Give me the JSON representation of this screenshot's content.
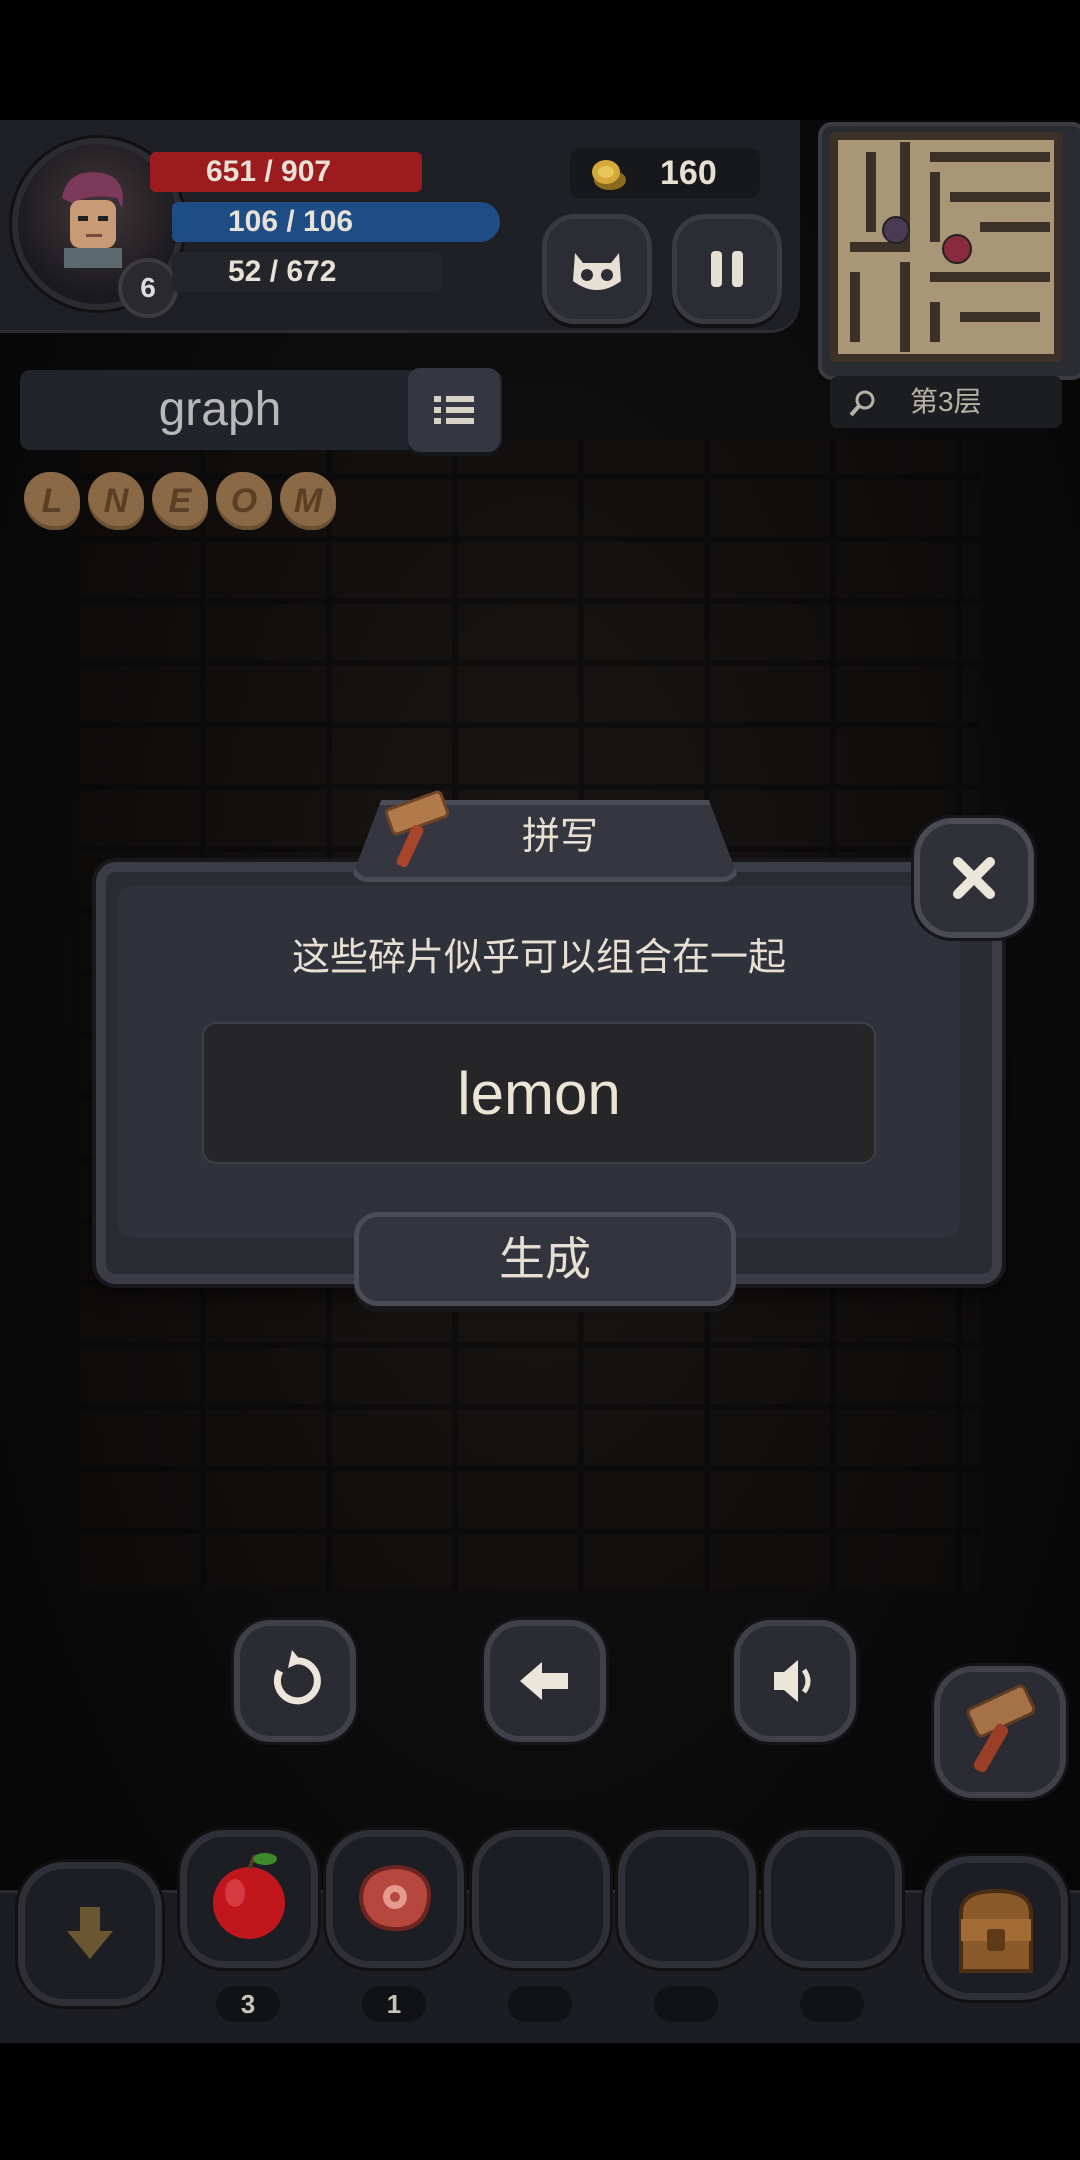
{
  "player": {
    "hp": "651 / 907",
    "mp": "106 / 106",
    "xp": "52 / 672",
    "level": "6"
  },
  "coins": "160",
  "floor_label": "第3层",
  "current_word": "graph",
  "letter_tiles": [
    "L",
    "N",
    "E",
    "O",
    "M"
  ],
  "dialog": {
    "title": "拼写",
    "message": "这些碎片似乎可以组合在一起",
    "input_value": "lemon",
    "generate_label": "生成"
  },
  "inventory": [
    {
      "item": "apple",
      "count": "3"
    },
    {
      "item": "meat",
      "count": "1"
    },
    {
      "item": "",
      "count": ""
    },
    {
      "item": "",
      "count": ""
    },
    {
      "item": "",
      "count": ""
    }
  ],
  "icons": {
    "reset": "undo-icon",
    "back": "arrow-left-icon",
    "sound": "speaker-icon",
    "hammer": "hammer-icon",
    "bag": "backpack-icon",
    "down": "arrow-down-icon"
  },
  "colors": {
    "hp": "#9b1b1e",
    "mp": "#1e4d86",
    "panel": "#2a2b33"
  }
}
